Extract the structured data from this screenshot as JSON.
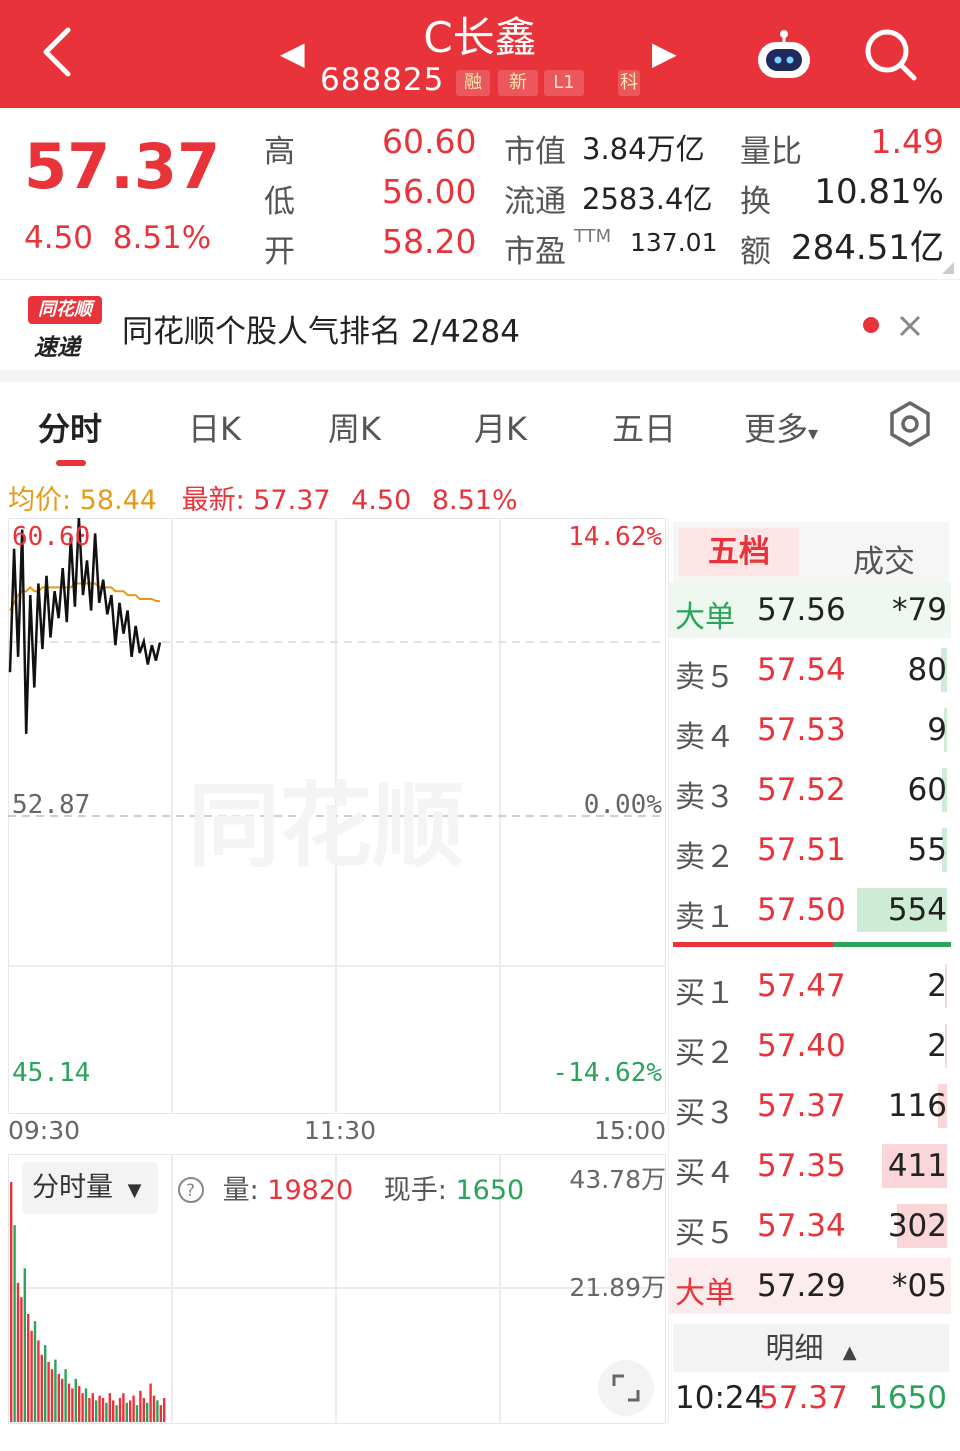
{
  "header": {
    "title": "C长鑫",
    "code": "688825",
    "tags": [
      "融",
      "新",
      "L1",
      "科"
    ],
    "colors": {
      "background": "#e8333a"
    },
    "icons": [
      "back-icon",
      "prev-stock-icon",
      "next-stock-icon",
      "robot-assistant-icon",
      "search-icon"
    ]
  },
  "quote": {
    "price": "57.37",
    "change": "4.50",
    "change_pct": "8.51%",
    "high_label": "高",
    "high": "60.60",
    "low_label": "低",
    "low": "56.00",
    "open_label": "开",
    "open": "58.20",
    "mktcap_label": "市值",
    "mktcap": "3.84万亿",
    "float_label": "流通",
    "float": "2583.4亿",
    "pe_label": "市盈",
    "pe_sup": "TTM",
    "pe": "137.01",
    "vr_label": "量比",
    "vr": "1.49",
    "turnover_label": "换",
    "turnover": "10.81%",
    "amount_label": "额",
    "amount": "284.51亿"
  },
  "rank_banner": {
    "logo_top": "同花顺",
    "logo_bottom": "速递",
    "text": "同花顺个股人气排名 2/4284"
  },
  "tabs": [
    "分时",
    "日K",
    "周K",
    "月K",
    "五日",
    "更多"
  ],
  "price_info": {
    "avg_label": "均价: 58.44",
    "latest_label": "最新: 57.37",
    "change": "4.50",
    "change_pct": "8.51%"
  },
  "chart_data": {
    "type": "line",
    "xlabel_ticks": [
      "09:30",
      "11:30",
      "15:00"
    ],
    "y_left": {
      "top": "60.60",
      "mid": "52.87",
      "bottom": "45.14"
    },
    "y_right": {
      "top": "14.62%",
      "mid": "0.00%",
      "bottom": "-14.62%"
    },
    "ylim": [
      45.14,
      60.6
    ],
    "prev_close": 52.87,
    "series": [
      {
        "values": [
          56.6,
          59.8,
          57.0,
          60.3,
          55.0,
          58.6,
          56.2,
          58.9,
          57.2,
          59.1,
          57.5,
          58.7,
          58.0,
          59.3,
          57.9,
          60.1,
          58.3,
          60.6,
          58.6,
          59.5,
          58.2,
          60.2,
          58.4,
          59.0,
          58.1,
          58.6,
          57.3,
          58.4,
          57.6,
          58.2,
          57.0,
          57.8,
          57.1,
          57.4,
          56.8,
          57.3,
          56.9,
          57.37
        ]
      },
      {
        "values": [
          58.2,
          58.4,
          58.6,
          58.7,
          58.7,
          58.8,
          58.7,
          58.7,
          58.8,
          58.8,
          58.8,
          58.8,
          58.8,
          58.8,
          58.8,
          58.8,
          58.9,
          58.9,
          58.9,
          58.9,
          58.9,
          58.9,
          58.8,
          58.8,
          58.8,
          58.8,
          58.7,
          58.7,
          58.7,
          58.6,
          58.6,
          58.6,
          58.5,
          58.5,
          58.5,
          58.5,
          58.45,
          58.44
        ]
      }
    ],
    "colors": {
      "price": "#111111",
      "avg": "#e59a18"
    }
  },
  "volume": {
    "selector": "分时量",
    "vol_label": "量: ",
    "vol": "19820",
    "hand_label": "现手: ",
    "hand": "1650",
    "scale_top": "43.78万",
    "scale_mid": "21.89万",
    "bars": [
      1.0,
      0.82,
      0.58,
      0.52,
      0.64,
      0.45,
      0.38,
      0.42,
      0.34,
      0.28,
      0.32,
      0.25,
      0.22,
      0.26,
      0.2,
      0.18,
      0.22,
      0.16,
      0.14,
      0.18,
      0.15,
      0.12,
      0.14,
      0.1,
      0.12,
      0.09,
      0.11,
      0.1,
      0.08,
      0.12,
      0.09,
      0.07,
      0.1,
      0.12,
      0.08,
      0.09,
      0.11,
      0.07,
      0.13,
      0.1,
      0.08,
      0.16,
      0.11,
      0.09,
      0.07,
      0.1
    ]
  },
  "orderbook": {
    "tab_on": "五档",
    "tab_off": "成交",
    "big_sell": {
      "label": "大单",
      "price": "57.56",
      "qty": "*79"
    },
    "asks": [
      {
        "label": "卖５",
        "price": "57.54",
        "qty": "80",
        "bar": 0.06
      },
      {
        "label": "卖４",
        "price": "57.53",
        "qty": "9",
        "bar": 0.03
      },
      {
        "label": "卖３",
        "price": "57.52",
        "qty": "60",
        "bar": 0.05
      },
      {
        "label": "卖２",
        "price": "57.51",
        "qty": "55",
        "bar": 0.05
      },
      {
        "label": "卖１",
        "price": "57.50",
        "qty": "554",
        "bar": 0.94
      }
    ],
    "bids": [
      {
        "label": "买１",
        "price": "57.47",
        "qty": "2",
        "bar": 0.02
      },
      {
        "label": "买２",
        "price": "57.40",
        "qty": "2",
        "bar": 0.02
      },
      {
        "label": "买３",
        "price": "57.37",
        "qty": "116",
        "bar": 0.09
      },
      {
        "label": "买４",
        "price": "57.35",
        "qty": "411",
        "bar": 0.68
      },
      {
        "label": "买５",
        "price": "57.34",
        "qty": "302",
        "bar": 0.52
      }
    ],
    "big_buy": {
      "label": "大单",
      "price": "57.29",
      "qty": "*05"
    },
    "detail_label": "明细",
    "last_tick": {
      "time": "10:24",
      "price": "57.37",
      "qty": "1650"
    },
    "colors": {
      "up": "#e8333a",
      "down": "#2aa35b"
    }
  }
}
